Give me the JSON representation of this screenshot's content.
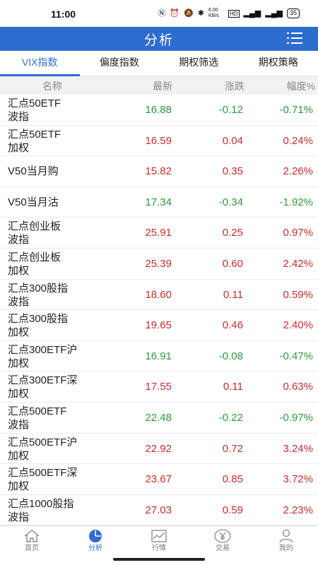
{
  "status_bar": {
    "time": "11:00",
    "battery": "35",
    "speed": "6.00 KB/s"
  },
  "header": {
    "title": "分析"
  },
  "tabs": [
    {
      "label": "VIX指数",
      "active": true
    },
    {
      "label": "偏度指数",
      "active": false
    },
    {
      "label": "期权筛选",
      "active": false
    },
    {
      "label": "期权策略",
      "active": false
    }
  ],
  "table": {
    "headers": {
      "name": "名称",
      "last": "最新",
      "change": "涨跌",
      "pct": "幅度%"
    },
    "rows": [
      {
        "name1": "汇点50ETF",
        "name2": "波指",
        "last": "16.88",
        "change": "-0.12",
        "pct": "-0.71%",
        "dir": "down"
      },
      {
        "name1": "汇点50ETF",
        "name2": "加权",
        "last": "16.59",
        "change": "0.04",
        "pct": "0.24%",
        "dir": "up"
      },
      {
        "name1": "V50当月购",
        "name2": "",
        "last": "15.82",
        "change": "0.35",
        "pct": "2.26%",
        "dir": "up"
      },
      {
        "name1": "V50当月沽",
        "name2": "",
        "last": "17.34",
        "change": "-0.34",
        "pct": "-1.92%",
        "dir": "down"
      },
      {
        "name1": "汇点创业板",
        "name2": "波指",
        "last": "25.91",
        "change": "0.25",
        "pct": "0.97%",
        "dir": "up"
      },
      {
        "name1": "汇点创业板",
        "name2": "加权",
        "last": "25.39",
        "change": "0.60",
        "pct": "2.42%",
        "dir": "up"
      },
      {
        "name1": "汇点300股指",
        "name2": "波指",
        "last": "18.60",
        "change": "0.11",
        "pct": "0.59%",
        "dir": "up"
      },
      {
        "name1": "汇点300股指",
        "name2": "加权",
        "last": "19.65",
        "change": "0.46",
        "pct": "2.40%",
        "dir": "up"
      },
      {
        "name1": "汇点300ETF沪",
        "name2": "加权",
        "last": "16.91",
        "change": "-0.08",
        "pct": "-0.47%",
        "dir": "down"
      },
      {
        "name1": "汇点300ETF深",
        "name2": "加权",
        "last": "17.55",
        "change": "0.11",
        "pct": "0.63%",
        "dir": "up"
      },
      {
        "name1": "汇点500ETF",
        "name2": "波指",
        "last": "22.48",
        "change": "-0.22",
        "pct": "-0.97%",
        "dir": "down"
      },
      {
        "name1": "汇点500ETF沪",
        "name2": "加权",
        "last": "22.92",
        "change": "0.72",
        "pct": "3.24%",
        "dir": "up"
      },
      {
        "name1": "汇点500ETF深",
        "name2": "加权",
        "last": "23.67",
        "change": "0.85",
        "pct": "3.72%",
        "dir": "up"
      },
      {
        "name1": "汇点1000股指",
        "name2": "波指",
        "last": "27.03",
        "change": "0.59",
        "pct": "2.23%",
        "dir": "up"
      }
    ]
  },
  "bottom_nav": [
    {
      "label": "首页",
      "icon": "home-icon",
      "active": false
    },
    {
      "label": "分析",
      "icon": "pie-chart-icon",
      "active": true
    },
    {
      "label": "行情",
      "icon": "line-chart-icon",
      "active": false
    },
    {
      "label": "交易",
      "icon": "yen-icon",
      "active": false
    },
    {
      "label": "我的",
      "icon": "user-icon",
      "active": false
    }
  ],
  "colors": {
    "brand": "#2e6dd0",
    "up": "#c62d2d",
    "down": "#2b9a3c"
  }
}
